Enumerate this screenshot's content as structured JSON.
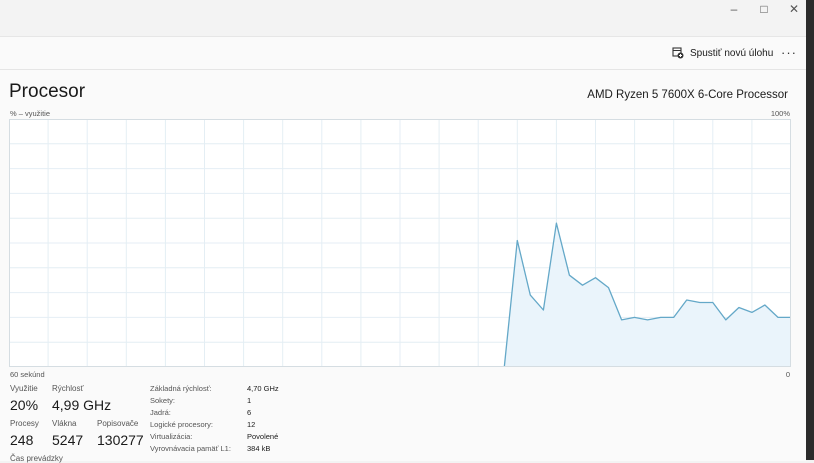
{
  "window": {
    "min_icon": "minimize-icon",
    "max_icon": "maximize-icon",
    "close_icon": "close-icon"
  },
  "toolbar": {
    "run_task_label": "Spustiť novú úlohu",
    "more_label": "···"
  },
  "header": {
    "title": "Procesor",
    "cpu_model": "AMD Ryzen 5 7600X 6-Core Processor"
  },
  "chart_labels": {
    "ylabel": "% – využitie",
    "ymax_label": "100%",
    "x_left_label": "60 sekúnd",
    "x_right_label": "0"
  },
  "stats": {
    "utilization_label": "Využitie",
    "utilization_value": "20%",
    "speed_label": "Rýchlosť",
    "speed_value": "4,99 GHz",
    "processes_label": "Procesy",
    "processes_value": "248",
    "threads_label": "Vlákna",
    "threads_value": "5247",
    "handles_label": "Popisovače",
    "handles_value": "130277",
    "uptime_label": "Čas prevádzky"
  },
  "info": [
    {
      "label": "Základná rýchlosť:",
      "value": "4,70 GHz"
    },
    {
      "label": "Sokety:",
      "value": "1"
    },
    {
      "label": "Jadrá:",
      "value": "6"
    },
    {
      "label": "Logické procesory:",
      "value": "12"
    },
    {
      "label": "Virtualizácia:",
      "value": "Povolené"
    },
    {
      "label": "Vyrovnávacia pamäť L1:",
      "value": "384 kB"
    }
  ],
  "colors": {
    "line": "#64a8c8",
    "fill": "#eaf4fb",
    "grid": "#e4eef4",
    "border": "#d5dde2"
  },
  "chart_data": {
    "type": "area",
    "title": "",
    "xlabel": "60 sekúnd",
    "ylabel": "% – využitie",
    "ylim": [
      0,
      100
    ],
    "xlim": [
      60,
      0
    ],
    "grid": true,
    "x": [
      22,
      21,
      20,
      19,
      18,
      17,
      16,
      15,
      14,
      13,
      12,
      11,
      10,
      9,
      8,
      7,
      6,
      5,
      4,
      3,
      2,
      1,
      0
    ],
    "values": [
      0,
      51,
      29,
      23,
      58,
      37,
      33,
      36,
      32,
      19,
      20,
      19,
      20,
      20,
      27,
      26,
      26,
      19,
      24,
      22,
      25,
      20,
      20
    ]
  }
}
